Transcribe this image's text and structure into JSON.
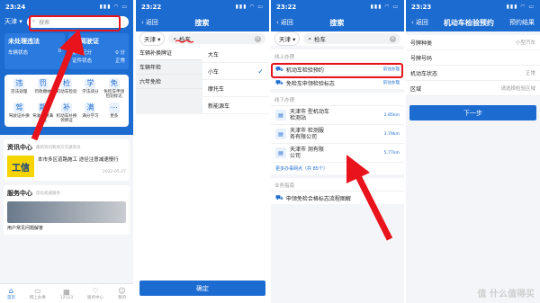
{
  "panel1": {
    "status_time": "23:24",
    "city": "天津",
    "search_placeholder": "搜索",
    "card_left": {
      "title": "未处理违法",
      "sub_label": "车辆状态",
      "sub_value": "0"
    },
    "card_right": {
      "title": "驾驶证",
      "line1_label": "累积记分",
      "line1_value": "0 分",
      "line2_label": "证件状态",
      "line2_value": "正常"
    },
    "services": [
      {
        "icon": "违",
        "label": "违法处理"
      },
      {
        "icon": "罚",
        "label": "罚款缴纳"
      },
      {
        "icon": "检",
        "label": "机动车检验"
      },
      {
        "icon": "学",
        "label": "学法减分"
      },
      {
        "icon": "免",
        "label": "免检车申领检验标志"
      },
      {
        "icon": "驾",
        "label": "驾驶证补换"
      },
      {
        "icon": "期",
        "label": "驾驶证期满换证"
      },
      {
        "icon": "补",
        "label": "机动车补换领牌证"
      },
      {
        "icon": "满",
        "label": "满分学习"
      },
      {
        "icon": "⋯",
        "label": "更多"
      }
    ],
    "news_section": {
      "title": "资讯中心",
      "subtitle": "最新资讯和地方交通资讯",
      "thumb_text": "工信",
      "headline": "本市多区道路施工 途径注意减速慢行",
      "date": "2022-05-27"
    },
    "service_section": {
      "title": "服务中心",
      "subtitle": "优化权威服务",
      "caption": "用户常见问题解答"
    },
    "tabs": [
      {
        "icon": "⌂",
        "label": "首页"
      },
      {
        "icon": "▭",
        "label": "网上办事"
      },
      {
        "icon": "▦",
        "label": "12123"
      },
      {
        "icon": "♡",
        "label": "服务中心"
      },
      {
        "icon": "☺",
        "label": "我的"
      }
    ]
  },
  "panel2": {
    "status_time": "23:22",
    "back": "返回",
    "title": "搜索",
    "city": "天津",
    "query": "检车",
    "left_items": [
      "车辆补换牌证",
      "车辆年检",
      "六年免检"
    ],
    "right_items": [
      {
        "label": "大车",
        "checked": false
      },
      {
        "label": "小车",
        "checked": true
      },
      {
        "label": "摩托车",
        "checked": false
      },
      {
        "label": "新能源车",
        "checked": false
      }
    ],
    "confirm": "确定"
  },
  "panel3": {
    "status_time": "23:22",
    "back": "返回",
    "title": "搜索",
    "city": "天津",
    "query": "检车",
    "online_header": "线上办理",
    "online_items": [
      {
        "label": "机动车检验预约",
        "action": "前往办理"
      },
      {
        "label": "免检车申领检验标志",
        "action": "前往办理"
      }
    ],
    "offline_header": "线下办理",
    "offline_items": [
      {
        "line1": "天津市 型机动车",
        "line2": "检测站",
        "dist": "2.85km"
      },
      {
        "line1": "天津市 检测服",
        "line2": "务有限公司",
        "dist": "3.79km"
      },
      {
        "line1": "天津市 测有限",
        "line2": "公司",
        "dist": "5.77km"
      }
    ],
    "more": "更多办事网点（共 85个）",
    "biz_header": "业务指南",
    "biz_item": "申领免检合格标志流程图解"
  },
  "panel4": {
    "status_time": "23:23",
    "back": "返回",
    "title": "机动车检验预约",
    "result_tab": "预约结果",
    "fields": [
      {
        "label": "号牌种类",
        "value": "小型汽车"
      },
      {
        "label": "号牌号码",
        "value": ""
      },
      {
        "label": "机动车状态",
        "value": "正常"
      },
      {
        "label": "区域",
        "value": "请选择检验区域"
      }
    ],
    "next": "下一步"
  },
  "watermark": "值 什么值得买",
  "colors": {
    "brand_blue": "#1c6bd1",
    "highlight_red": "#e8131b"
  }
}
